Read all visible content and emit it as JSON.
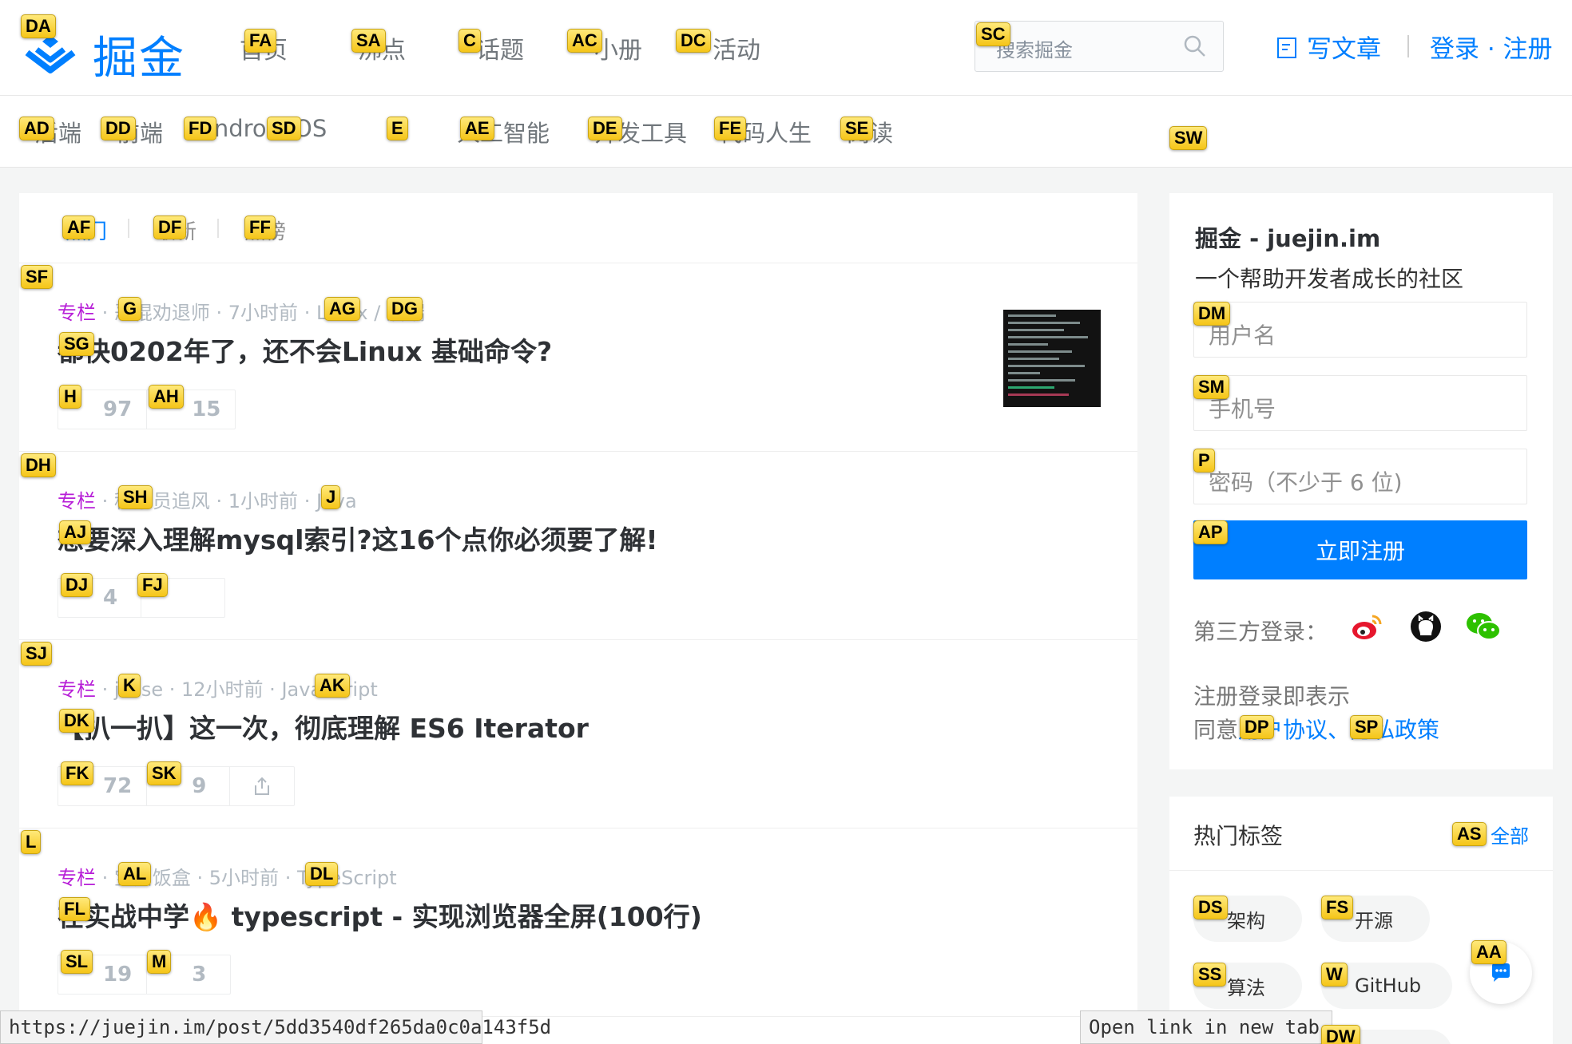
{
  "header": {
    "logo_text": "掘金",
    "nav": [
      "首页",
      "沸点",
      "话题",
      "小册",
      "活动"
    ],
    "search_placeholder": "搜索掘金",
    "write_label": "写文章",
    "login_label": "登录 · 注册"
  },
  "categories": [
    "后端",
    "前端",
    "Android",
    "iOS",
    "人工智能",
    "开发工具",
    "代码人生",
    "阅读"
  ],
  "feed_tabs": [
    "热门",
    "最新",
    "热榜"
  ],
  "entries": [
    {
      "column": "专栏",
      "author": "恶棍劝退师",
      "time": "7小时前",
      "tags": "Linux / 后端",
      "title": "都快0202年了，还不会Linux 基础命令?",
      "likes": "97",
      "comments": "15"
    },
    {
      "column": "专栏",
      "author": "程序员追风",
      "time": "1小时前",
      "tags": "Java",
      "title": "想要深入理解mysql索引?这16个点你必须要了解!",
      "likes": "4",
      "comments": ""
    },
    {
      "column": "专栏",
      "author": "jesse",
      "time": "12小时前",
      "tags": "JavaScript",
      "title": "【扒一扒】这一次，彻底理解 ES6 Iterator",
      "likes": "72",
      "comments": "9"
    },
    {
      "column": "专栏",
      "author": "宝贝饭盒",
      "time": "5小时前",
      "tags": "TypeScript",
      "title": "在实战中学🔥 typescript - 实现浏览器全屏(100行)",
      "likes": "19",
      "comments": "3"
    }
  ],
  "sidebar": {
    "site_title": "掘金 - juejin.im",
    "site_subtitle": "一个帮助开发者成长的社区",
    "username_placeholder": "用户名",
    "phone_placeholder": "手机号",
    "password_placeholder": "密码（不少于 6 位)",
    "register_button": "立即注册",
    "third_party_label": "第三方登录：",
    "agree_line1": "注册登录即表示",
    "agree_prefix": "同意",
    "agree_link1": "用户协议",
    "agree_sep": "、",
    "agree_link2": "隐私政策",
    "hot_tags_title": "热门标签",
    "hot_tags_all": "全部",
    "hot_tags": [
      "架构",
      "开源",
      "算法",
      "GitHub"
    ]
  },
  "status_bar": {
    "url": "https://juejin.im/post/5dd3540df265da0c0a143f5d",
    "tooltip": "Open link in new tab."
  },
  "hints": {
    "logo": "DA",
    "nav0": "FA",
    "nav1": "SA",
    "nav2": "C",
    "nav3": "AC",
    "nav4": "DC",
    "search": "SC",
    "catbar": "SW",
    "cat0": "AD",
    "cat1": "DD",
    "cat2": "FD",
    "cat3": "SD",
    "cat4": "E",
    "cat5": "AE",
    "cat6": "DE",
    "cat7": "FE",
    "cat8": "SE",
    "tab0": "AF",
    "tab1": "DF",
    "tab2": "FF",
    "e0": "SF",
    "e0_author": "G",
    "e0_tag1": "AG",
    "e0_tag2": "DG",
    "e0_title": "SG",
    "e0_like": "H",
    "e0_comment": "AH",
    "e1": "DH",
    "e1_author": "SH",
    "e1_tag": "J",
    "e1_title": "AJ",
    "e1_like": "DJ",
    "e1_comment": "FJ",
    "e2": "SJ",
    "e2_author": "K",
    "e2_tag": "AK",
    "e2_title": "DK",
    "e2_like": "FK",
    "e2_comment": "SK",
    "e3": "L",
    "e3_author": "AL",
    "e3_tag": "DL",
    "e3_title": "FL",
    "e3_like": "SL",
    "e3_comment": "M",
    "username": "DM",
    "phone": "SM",
    "password": "P",
    "register": "AP",
    "agree1": "DP",
    "agree2": "SP",
    "all_tags": "AS",
    "tag0": "DS",
    "tag1": "FS",
    "tag2": "SS",
    "tag3": "W",
    "fab": "AA",
    "tag4": "DW"
  }
}
